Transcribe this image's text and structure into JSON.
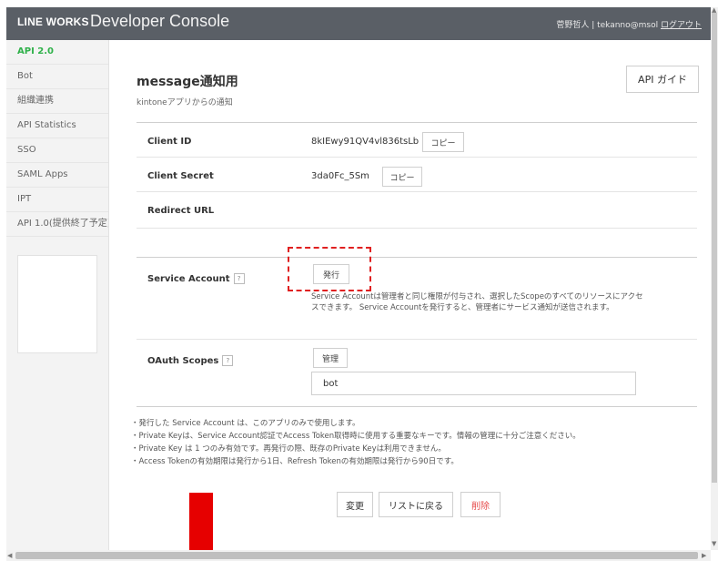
{
  "header": {
    "brand": "LINE WORKS",
    "console_title": "Developer Console",
    "user": "菅野哲人 | tekanno@msol",
    "logout": "ログアウト"
  },
  "sidebar": {
    "items": [
      {
        "label": "API 2.0",
        "active": true
      },
      {
        "label": "Bot",
        "active": false
      },
      {
        "label": "組織連携",
        "active": false
      },
      {
        "label": "API Statistics",
        "active": false
      },
      {
        "label": "SSO",
        "active": false
      },
      {
        "label": "SAML Apps",
        "active": false
      },
      {
        "label": "IPT",
        "active": false
      },
      {
        "label": "API 1.0(提供終了予定)",
        "active": false
      }
    ]
  },
  "app": {
    "title": "message通知用",
    "description": "kintoneアプリからの通知",
    "api_guide": "API ガイド"
  },
  "fields": {
    "client_id_label": "Client ID",
    "client_id_value": "8kIEwy91QV4vl836tsLb",
    "client_secret_label": "Client Secret",
    "client_secret_value": "3da0Fc_5Sm",
    "copy": "コピー",
    "redirect_label": "Redirect URL",
    "service_account_label": "Service Account",
    "help": "?",
    "issue_button": "発行",
    "sa_description": "Service Accountは管理者と同じ権限が付与され、選択したScopeのすべてのリソースにアクセスできます。 Service Accountを発行すると、管理者にサービス通知が送信されます。",
    "oauth_label": "OAuth Scopes",
    "manage_button": "管理",
    "scope_value": "bot"
  },
  "notes": [
    "・発行した Service Account は、このアプリのみで使用します。",
    "・Private Keyは、Service Account認証でAccess Token取得時に使用する重要なキーです。情報の管理に十分ご注意ください。",
    "・Private Key は 1 つのみ有効です。再発行の際、既存のPrivate Keyは利用できません。",
    "・Access Tokenの有効期限は発行から1日、Refresh Tokenの有効期限は発行から90日です。"
  ],
  "actions": {
    "edit": "変更",
    "back": "リストに戻る",
    "delete": "削除"
  },
  "colors": {
    "header_bg": "#5a5f66",
    "active_green": "#2fb14a",
    "annotation_red": "#e02020",
    "delete_red": "#e64b4b"
  }
}
